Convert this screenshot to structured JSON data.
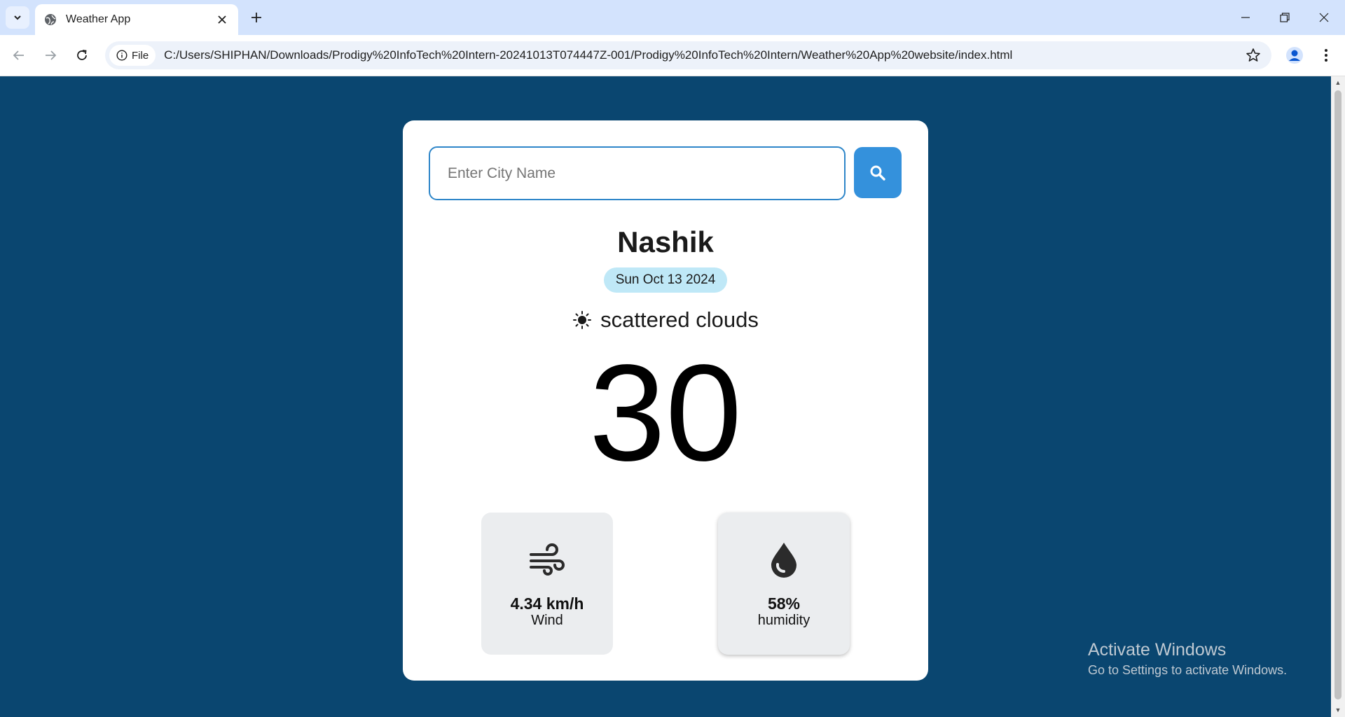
{
  "browser": {
    "tab_title": "Weather App",
    "address_chip": "File",
    "url": "C:/Users/SHIPHAN/Downloads/Prodigy%20InfoTech%20Intern-20241013T074447Z-001/Prodigy%20InfoTech%20Intern/Weather%20App%20website/index.html"
  },
  "search": {
    "placeholder": "Enter City Name",
    "value": ""
  },
  "weather": {
    "city": "Nashik",
    "date": "Sun Oct 13 2024",
    "condition_icon": "sun-icon",
    "condition": "scattered clouds",
    "temperature": "30",
    "wind": {
      "value": "4.34 km/h",
      "label": "Wind",
      "icon": "wind-icon"
    },
    "humidity": {
      "value": "58%",
      "label": "humidity",
      "icon": "water-drop-icon"
    }
  },
  "watermark": {
    "title": "Activate Windows",
    "subtitle": "Go to Settings to activate Windows."
  },
  "colors": {
    "page_background": "#0a4670",
    "search_button": "#3491dc",
    "date_badge": "#bfe8f7",
    "stat_card": "#ebedef"
  }
}
